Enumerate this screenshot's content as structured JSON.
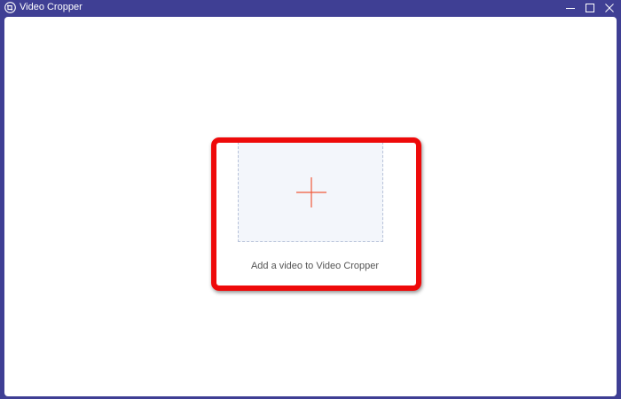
{
  "window": {
    "title": "Video Cropper",
    "app_icon": "video-crop-icon",
    "controls": {
      "minimize_icon": "minimize-icon",
      "maximize_icon": "maximize-icon",
      "close_icon": "close-icon"
    }
  },
  "main": {
    "drop_zone": {
      "icon": "plus-icon",
      "label": "Add a video to Video Cropper"
    }
  },
  "colors": {
    "titlebar": "#3f3f94",
    "accent_plus": "#f05a3a",
    "highlight": "#ee0a0a",
    "drop_zone_bg": "#f3f6fb"
  }
}
